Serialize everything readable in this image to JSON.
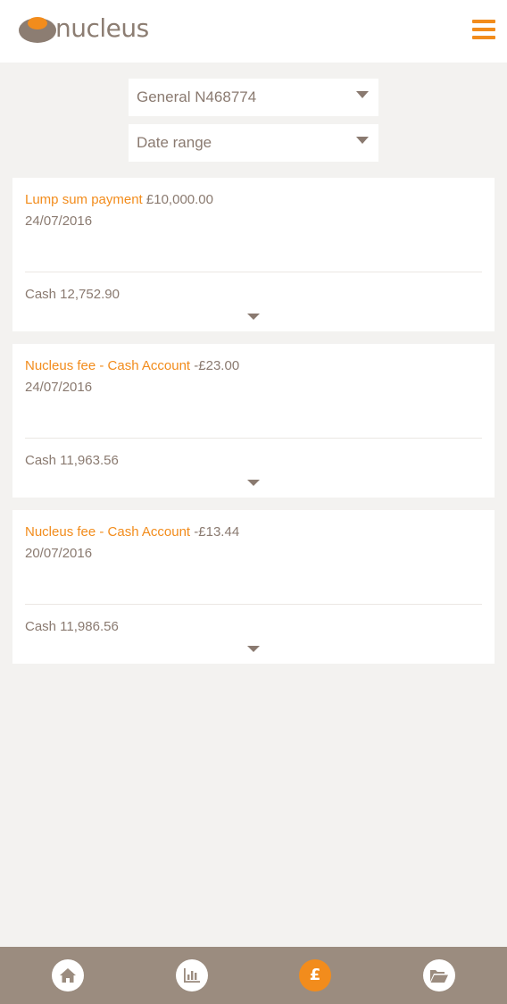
{
  "header": {
    "logo_text": "nucleus",
    "menu_icon": "hamburger-icon",
    "accent_color": "#f28c1c"
  },
  "filters": {
    "account": {
      "value": "General N468774"
    },
    "date_range": {
      "value": "Date range"
    }
  },
  "transactions": [
    {
      "description": "Lump sum payment",
      "amount": "£10,000.00",
      "date": "24/07/2016",
      "cash": "Cash 12,752.90"
    },
    {
      "description": "Nucleus fee - Cash Account",
      "amount": "-£23.00",
      "date": "24/07/2016",
      "cash": "Cash 11,963.56"
    },
    {
      "description": "Nucleus fee - Cash Account",
      "amount": "-£13.44",
      "date": "20/07/2016",
      "cash": "Cash 11,986.56"
    }
  ],
  "bottom_nav": {
    "items": [
      {
        "icon": "home-icon"
      },
      {
        "icon": "bar-chart-icon"
      },
      {
        "icon": "pound-icon",
        "glyph": "£",
        "active": true
      },
      {
        "icon": "folder-open-icon"
      }
    ]
  }
}
